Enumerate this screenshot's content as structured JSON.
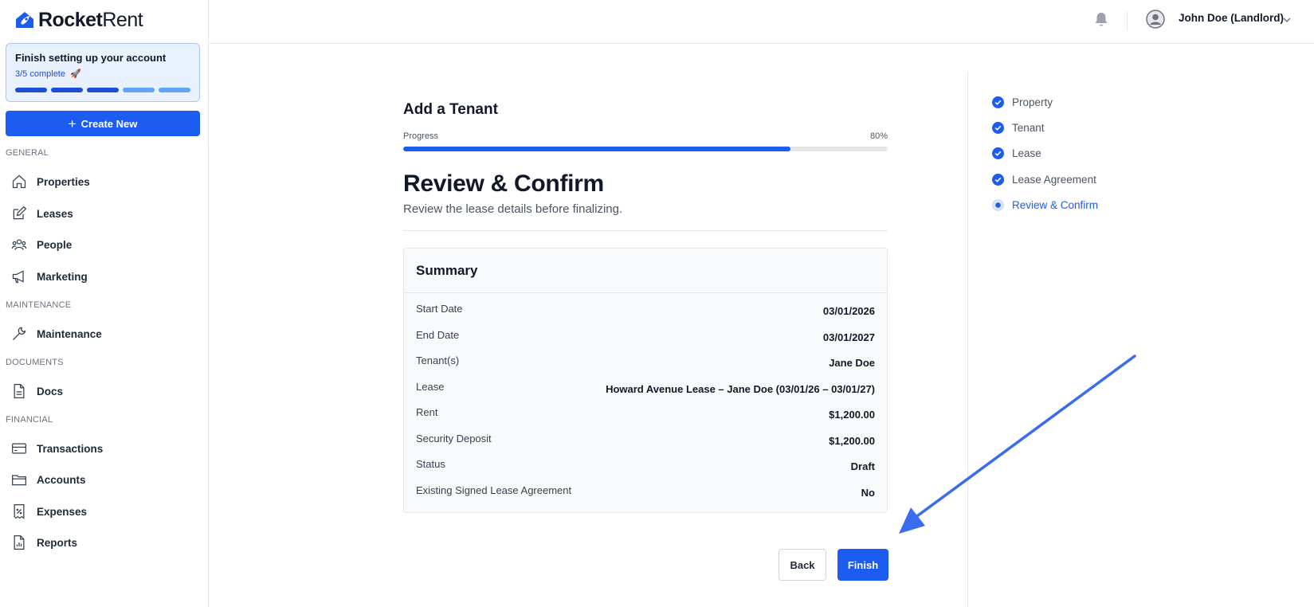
{
  "brand": {
    "name_bold": "Rocket",
    "name_light": "Rent"
  },
  "setup": {
    "title": "Finish setting up your account",
    "progress_text": "3/5 complete",
    "emoji": "🚀",
    "completed_steps": 3,
    "total_steps": 5,
    "colors": {
      "done": "#1d4ed8",
      "todo": "#60a5fa"
    }
  },
  "create_button": {
    "label": "Create New",
    "icon": "plus-icon"
  },
  "sidebar": {
    "sections": [
      {
        "label": "GENERAL",
        "items": [
          {
            "label": "Properties",
            "icon": "home-icon"
          },
          {
            "label": "Leases",
            "icon": "pencil-square-icon"
          },
          {
            "label": "People",
            "icon": "users-icon"
          },
          {
            "label": "Marketing",
            "icon": "megaphone-icon"
          }
        ]
      },
      {
        "label": "MAINTENANCE",
        "items": [
          {
            "label": "Maintenance",
            "icon": "wrench-icon"
          }
        ]
      },
      {
        "label": "DOCUMENTS",
        "items": [
          {
            "label": "Docs",
            "icon": "document-icon"
          }
        ]
      },
      {
        "label": "FINANCIAL",
        "items": [
          {
            "label": "Transactions",
            "icon": "credit-card-icon"
          },
          {
            "label": "Accounts",
            "icon": "folder-icon"
          },
          {
            "label": "Expenses",
            "icon": "receipt-icon"
          },
          {
            "label": "Reports",
            "icon": "report-icon"
          }
        ]
      }
    ]
  },
  "header": {
    "user_name": "John Doe (Landlord)"
  },
  "wizard": {
    "title": "Add a Tenant",
    "progress_label": "Progress",
    "progress_text": "80%",
    "progress_value": 0.8,
    "step_title": "Review & Confirm",
    "step_subtitle": "Review the lease details before finalizing.",
    "summary": {
      "title": "Summary",
      "rows": [
        {
          "label": "Start Date",
          "value": "03/01/2026"
        },
        {
          "label": "End Date",
          "value": "03/01/2027"
        },
        {
          "label": "Tenant(s)",
          "value": "Jane Doe"
        },
        {
          "label": "Lease",
          "value": "Howard Avenue Lease – Jane Doe (03/01/26 – 03/01/27)"
        },
        {
          "label": "Rent",
          "value": "$1,200.00"
        },
        {
          "label": "Security Deposit",
          "value": "$1,200.00"
        },
        {
          "label": "Status",
          "value": "Draft"
        },
        {
          "label": "Existing Signed Lease Agreement",
          "value": "No"
        }
      ]
    },
    "back_label": "Back",
    "finish_label": "Finish"
  },
  "steps": [
    {
      "label": "Property",
      "state": "done"
    },
    {
      "label": "Tenant",
      "state": "done"
    },
    {
      "label": "Lease",
      "state": "done"
    },
    {
      "label": "Lease Agreement",
      "state": "done"
    },
    {
      "label": "Review & Confirm",
      "state": "active"
    }
  ],
  "colors": {
    "accent": "#1d5cf0",
    "annotation_arrow": "#3b6cf0"
  }
}
